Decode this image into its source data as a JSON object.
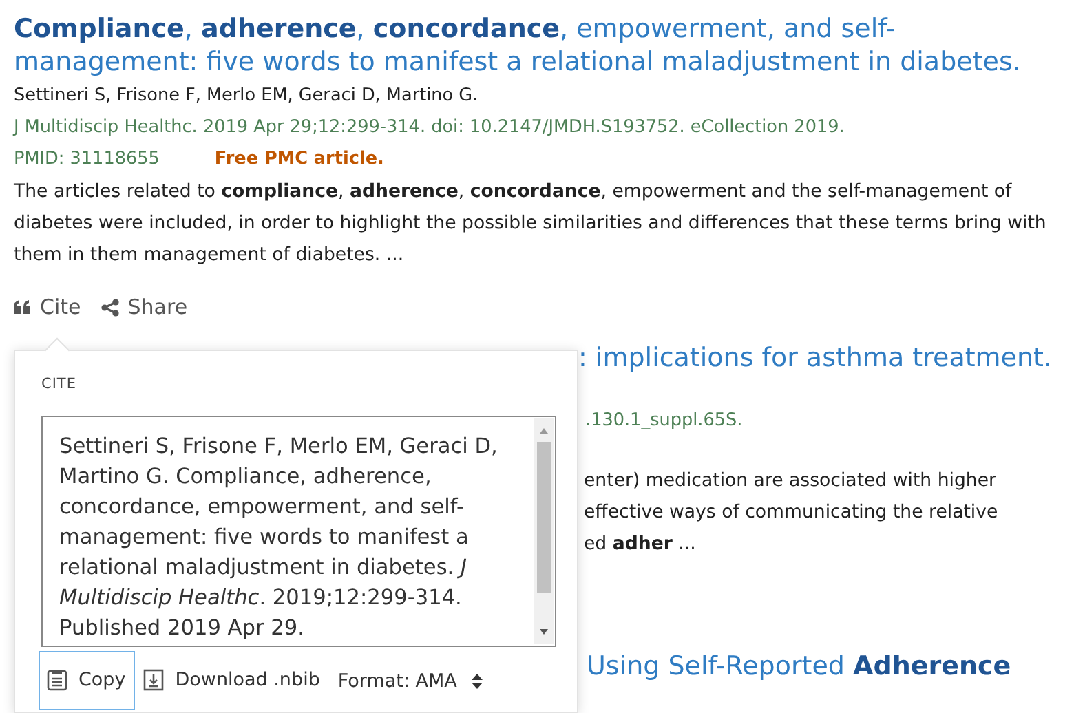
{
  "article": {
    "title": "**Compliance**, **adherence**, **concordance**, empowerment, and self-management: five words to manifest a relational maladjustment in diabetes.",
    "authors": "Settineri S, Frisone F, Merlo EM, Geraci D, Martino G.",
    "citation": "J Multidiscip Healthc. 2019 Apr 29;12:299-314. doi: 10.2147/JMDH.S193752. eCollection 2019.",
    "pmid": "PMID: 31118655",
    "free_label": "Free PMC article.",
    "snippet": "The articles related to **compliance**, **adherence**, **concordance**, empowerment and the self-management of diabetes were included, in order to highlight the possible similarities and differences that these terms bring with them in them management of diabetes. ...",
    "actions": [
      {
        "kind": "quote",
        "label": "Cite"
      },
      {
        "kind": "share",
        "label": "Share"
      }
    ]
  },
  "hidden_results": [
    {
      "title_fragment": ": implications for asthma treatment.",
      "citation_fragment": ".130.1_suppl.65S.",
      "snippet_lines": [
        "enter) medication are associated with higher",
        "effective ways of communicating the relative",
        "ed **adher** ..."
      ]
    },
    {
      "title_fragment": "Using Self-Reported **Adherence**"
    }
  ],
  "cite_popup": {
    "heading": "CITE",
    "citation_text": "Settineri S, Frisone F, Merlo EM, Geraci D, Martino G. Compliance, adherence, concordance, empowerment, and self-management: five words to manifest a relational maladjustment in diabetes. *J Multidiscip Healthc*. 2019;12:299-314. Published 2019 Apr 29.",
    "buttons": [
      {
        "kind": "copy",
        "label": "Copy",
        "focused": true
      },
      {
        "kind": "download",
        "label": "Download .nbib",
        "focused": false
      }
    ],
    "format": {
      "label": "Format: AMA"
    }
  }
}
